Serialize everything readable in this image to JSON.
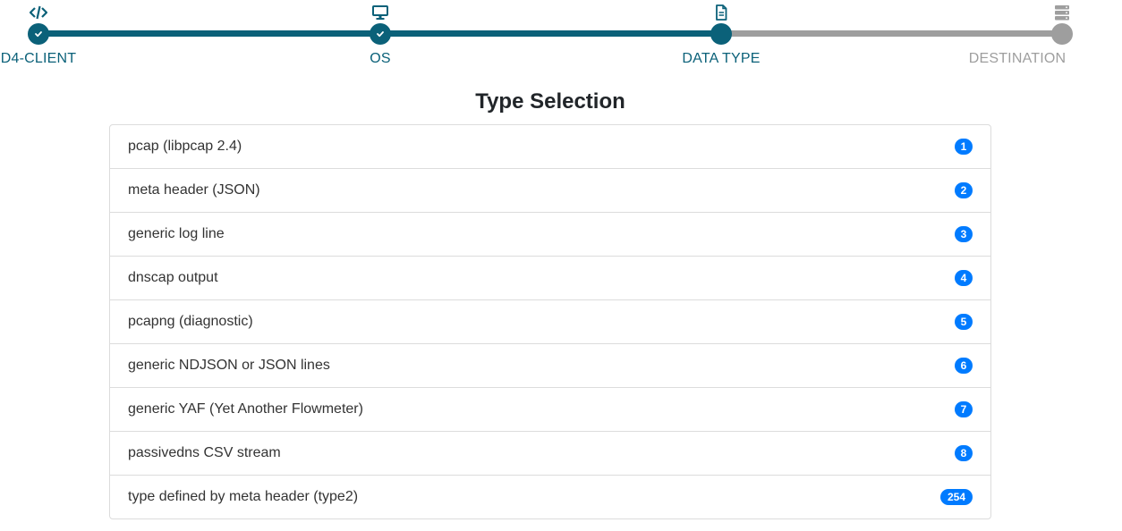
{
  "colors": {
    "step_done": "#0b6179",
    "step_todo": "#9e9e9e",
    "badge": "#007bff"
  },
  "stepper": {
    "steps": [
      {
        "label": "D4-CLIENT",
        "icon": "code-icon",
        "state": "done"
      },
      {
        "label": "OS",
        "icon": "monitor-icon",
        "state": "done"
      },
      {
        "label": "DATA TYPE",
        "icon": "file-icon",
        "state": "current"
      },
      {
        "label": "DESTINATION",
        "icon": "server-icon",
        "state": "todo"
      }
    ]
  },
  "main": {
    "title": "Type Selection",
    "types": [
      {
        "label": "pcap (libpcap 2.4)",
        "badge": "1"
      },
      {
        "label": "meta header (JSON)",
        "badge": "2"
      },
      {
        "label": "generic log line",
        "badge": "3"
      },
      {
        "label": "dnscap output",
        "badge": "4"
      },
      {
        "label": "pcapng (diagnostic)",
        "badge": "5"
      },
      {
        "label": "generic NDJSON or JSON lines",
        "badge": "6"
      },
      {
        "label": "generic YAF (Yet Another Flowmeter)",
        "badge": "7"
      },
      {
        "label": "passivedns CSV stream",
        "badge": "8"
      },
      {
        "label": "type defined by meta header (type2)",
        "badge": "254"
      }
    ]
  }
}
